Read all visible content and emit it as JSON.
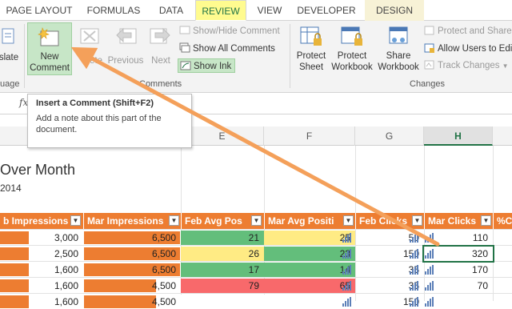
{
  "tabs": [
    {
      "label": "PAGE LAYOUT"
    },
    {
      "label": "FORMULAS"
    },
    {
      "label": "DATA"
    },
    {
      "label": "REVIEW"
    },
    {
      "label": "VIEW"
    },
    {
      "label": "DEVELOPER"
    },
    {
      "label": "DESIGN"
    }
  ],
  "ribbon": {
    "left_cut_1": "slate",
    "left_cut_2": "uage",
    "new_comment_1": "New",
    "new_comment_2": "Comment",
    "delete": "lete",
    "previous": "Previous",
    "next": "Next",
    "show_hide": "Show/Hide Comment",
    "show_all": "Show All Comments",
    "show_ink": "Show Ink",
    "comments_group": "Comments",
    "protect_sheet_1": "Protect",
    "protect_sheet_2": "Sheet",
    "protect_workbook_1": "Protect",
    "protect_workbook_2": "Workbook",
    "share_workbook_1": "Share",
    "share_workbook_2": "Workbook",
    "protect_share": "Protect and Share",
    "allow_users": "Allow Users to Edi",
    "track_changes": "Track Changes",
    "changes_group": "Changes"
  },
  "formula": {
    "fx": "fx"
  },
  "tooltip": {
    "title": "Insert a Comment (Shift+F2)",
    "body": "Add a note about this part of the document."
  },
  "columns": [
    "E",
    "F",
    "G",
    "H"
  ],
  "sheet": {
    "title": "Over Month",
    "subtitle": "2014"
  },
  "table": {
    "headers": [
      "b Impressions",
      "Mar Impressions",
      "Feb Avg Pos",
      "Mar Avg Positi",
      "Feb Clicks",
      "Mar Clicks",
      "%Cl"
    ],
    "rows": [
      {
        "feb_imp": "3,000",
        "mar_imp": "6,500",
        "feb_pos": "21",
        "mar_pos": "25",
        "feb_clicks": "50",
        "mar_clicks": "110"
      },
      {
        "feb_imp": "2,500",
        "mar_imp": "6,500",
        "feb_pos": "26",
        "mar_pos": "23",
        "feb_clicks": "150",
        "mar_clicks": "320"
      },
      {
        "feb_imp": "1,600",
        "mar_imp": "6,500",
        "feb_pos": "17",
        "mar_pos": "14",
        "feb_clicks": "35",
        "mar_clicks": "170"
      },
      {
        "feb_imp": "1,600",
        "mar_imp": "4,500",
        "feb_pos": "79",
        "mar_pos": "65",
        "feb_clicks": "35",
        "mar_clicks": "70"
      },
      {
        "feb_imp": "1,600",
        "mar_imp": "4,500",
        "feb_pos": "",
        "mar_pos": "",
        "feb_clicks": "150",
        "mar_clicks": ""
      }
    ]
  },
  "colors": {
    "accent": "#217346",
    "header_fill": "#ed7d31",
    "arrow": "#f4a05a",
    "green": "#63be7b",
    "yellow": "#ffeb84",
    "red": "#f8696b"
  }
}
